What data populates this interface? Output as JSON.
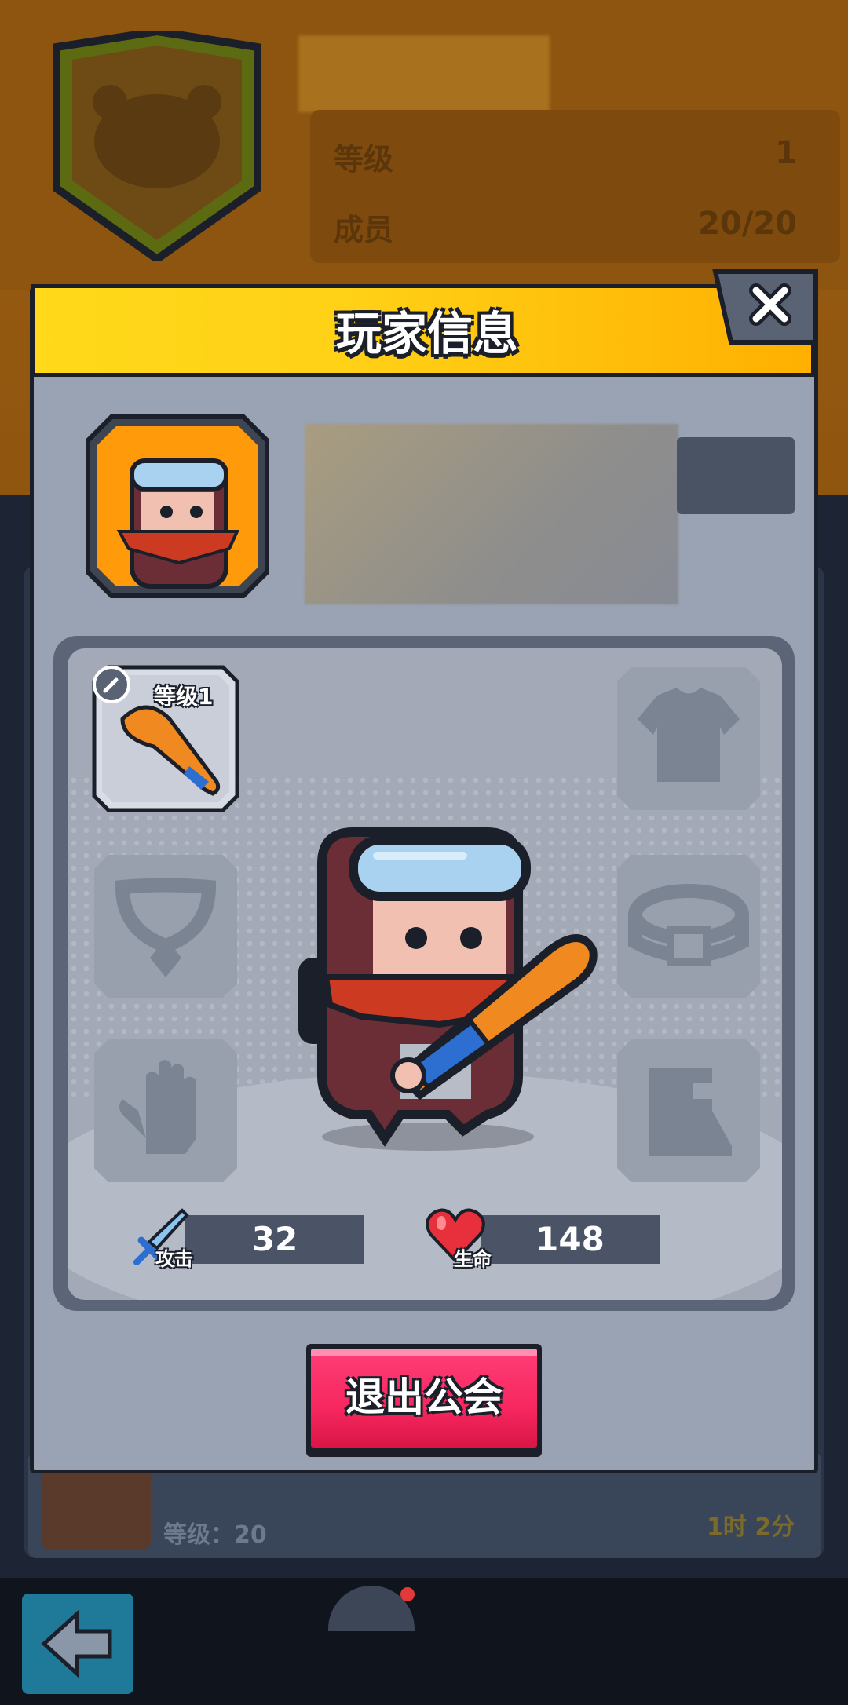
{
  "background": {
    "guild_stats": [
      {
        "label": "等级",
        "value": "1"
      },
      {
        "label": "成员",
        "value": "20/20"
      }
    ],
    "member_row": {
      "level_text": "等级：20",
      "time_text": "1时 2分"
    }
  },
  "dialog": {
    "title": "玩家信息",
    "weapon_level": "等级1",
    "attack_label": "攻击",
    "attack_value": "32",
    "hp_label": "生命",
    "hp_value": "148",
    "quit_label": "退出公会"
  },
  "colors": {
    "header_yellow": "#ffd117",
    "header_orange": "#ffb000",
    "quit_pink": "#f7275f",
    "panel_gray": "#9aa3b3",
    "outline": "#1b1f29"
  },
  "icons": [
    "close-icon",
    "sword-icon",
    "heart-icon",
    "shirt-icon",
    "necklace-icon",
    "belt-icon",
    "glove-icon",
    "boot-icon",
    "back-arrow-icon",
    "guild-icon",
    "bat-icon",
    "raccoon-emblem-icon"
  ]
}
